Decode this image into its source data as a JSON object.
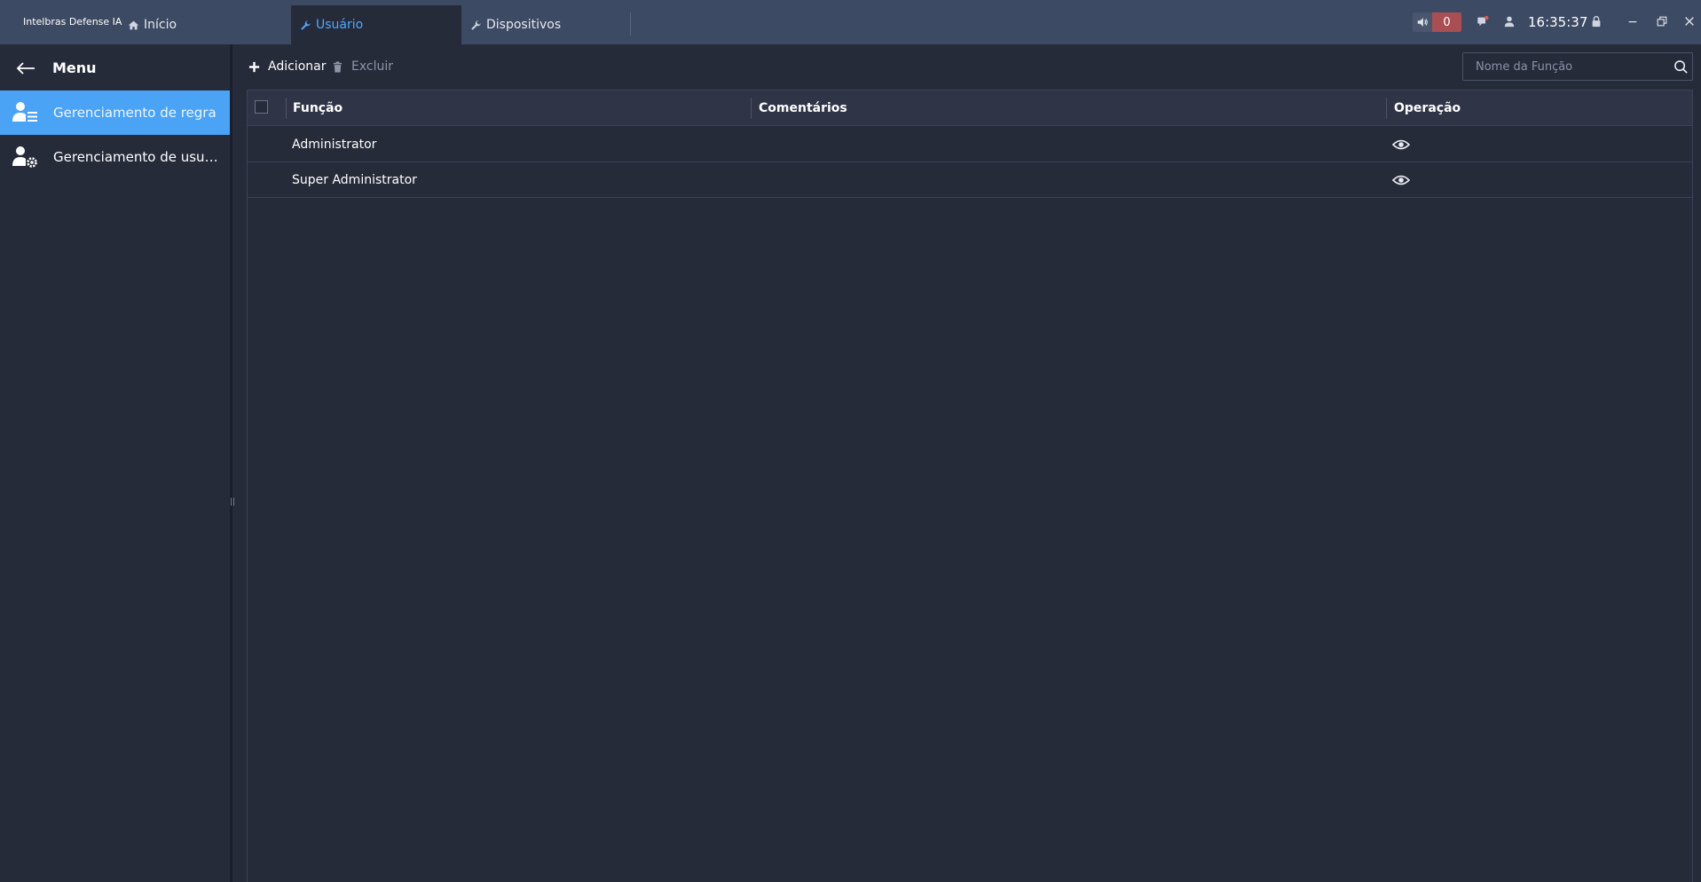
{
  "window": {
    "app_title": "Intelbras Defense IA",
    "tabs": [
      {
        "label": "Início",
        "icon": "home-icon"
      },
      {
        "label": "Usuário",
        "icon": "wrench-icon",
        "active": true
      },
      {
        "label": "Dispositivos",
        "icon": "wrench-icon"
      }
    ],
    "alarm_count": "0",
    "time": "16:35:37"
  },
  "sidebar": {
    "title": "Menu",
    "items": [
      {
        "label": "Gerenciamento de regra",
        "icon": "user-list-icon",
        "active": true
      },
      {
        "label": "Gerenciamento de usuários",
        "icon": "user-settings-icon"
      }
    ]
  },
  "toolbar": {
    "add_label": "Adicionar",
    "delete_label": "Excluir",
    "search_placeholder": "Nome da Função"
  },
  "table": {
    "columns": [
      "Função",
      "Comentários",
      "Operação"
    ],
    "rows": [
      {
        "funcao": "Administrator",
        "comentarios": "",
        "operacao": "view-icon"
      },
      {
        "funcao": "Super Administrator",
        "comentarios": "",
        "operacao": "view-icon"
      }
    ]
  },
  "colors": {
    "titlebar": "#3d4a63",
    "background": "#262b3a",
    "accent": "#4aa3f5",
    "alarm": "#a94f53"
  }
}
